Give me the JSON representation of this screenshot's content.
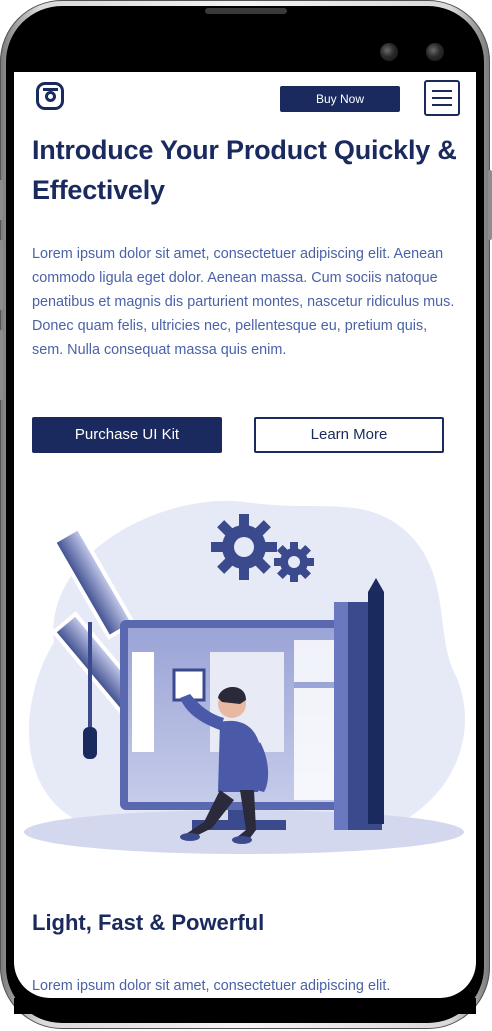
{
  "header": {
    "logo_icon": "logo-icon",
    "buy_now_label": "Buy Now",
    "menu_icon": "hamburger-menu-icon"
  },
  "hero": {
    "title": "Introduce Your Product Quickly & Effectively",
    "body": "Lorem ipsum dolor sit amet, consectetuer adipiscing elit. Aenean commodo ligula eget dolor. Aenean massa. Cum sociis natoque penatibus et magnis dis parturient montes, nascetur ridiculus mus. Donec quam felis, ultricies nec, pellentesque eu, pretium quis, sem. Nulla consequat massa quis enim.",
    "primary_button": "Purchase UI Kit",
    "secondary_button": "Learn More"
  },
  "section": {
    "title": "Light, Fast & Powerful",
    "body": "Lorem ipsum dolor sit amet, consectetuer adipiscing elit."
  },
  "colors": {
    "primary": "#1b2a5e",
    "body_text": "#4a62a8",
    "illustration_bg": "#e6e9f6",
    "illustration_accent": "#4a5aa8"
  }
}
